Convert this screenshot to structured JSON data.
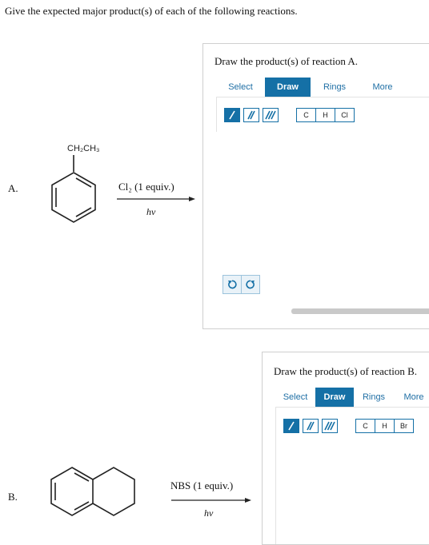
{
  "question": "Give the expected major product(s) of each of the following reactions.",
  "reaction_a": {
    "label": "A.",
    "substituent": "CH₂CH₃",
    "reagent": "Cl₂ (1 equiv.)",
    "condition": "hν"
  },
  "reaction_b": {
    "label": "B.",
    "reagent": "NBS (1 equiv.)",
    "condition": "hν"
  },
  "panel_a": {
    "title": "Draw the product(s) of reaction A.",
    "tabs": [
      "Select",
      "Draw",
      "Rings",
      "More"
    ],
    "active_tab": "Draw",
    "elements": [
      "C",
      "H",
      "Cl"
    ]
  },
  "panel_b": {
    "title": "Draw the product(s) of reaction B.",
    "tabs": [
      "Select",
      "Draw",
      "Rings",
      "More"
    ],
    "active_tab": "Draw",
    "elements": [
      "C",
      "H",
      "Br"
    ]
  },
  "colors": {
    "accent": "#1570a6",
    "border": "#cfcfcf"
  },
  "icons": [
    "single-bond-icon",
    "double-bond-icon",
    "triple-bond-icon",
    "undo-icon",
    "redo-icon"
  ]
}
